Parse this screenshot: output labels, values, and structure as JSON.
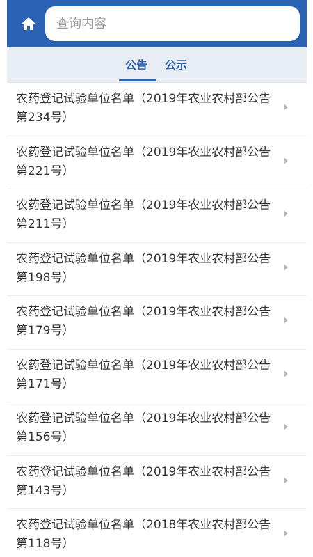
{
  "search": {
    "placeholder": "查询内容"
  },
  "tabs": [
    {
      "label": "公告",
      "active": true
    },
    {
      "label": "公示",
      "active": false
    }
  ],
  "colors": {
    "header": "#2c63b5",
    "tab_bar": "#e9eef5",
    "accent": "#2c63b5"
  },
  "list": [
    {
      "title": "农药登记试验单位名单（2019年农业农村部公告第234号）"
    },
    {
      "title": "农药登记试验单位名单（2019年农业农村部公告第221号）"
    },
    {
      "title": "农药登记试验单位名单（2019年农业农村部公告第211号）"
    },
    {
      "title": "农药登记试验单位名单（2019年农业农村部公告第198号）"
    },
    {
      "title": "农药登记试验单位名单（2019年农业农村部公告第179号）"
    },
    {
      "title": "农药登记试验单位名单（2019年农业农村部公告第171号）"
    },
    {
      "title": "农药登记试验单位名单（2019年农业农村部公告第156号）"
    },
    {
      "title": "农药登记试验单位名单（2019年农业农村部公告第143号）"
    },
    {
      "title": "农药登记试验单位名单（2018年农业农村部公告第118号）"
    }
  ]
}
